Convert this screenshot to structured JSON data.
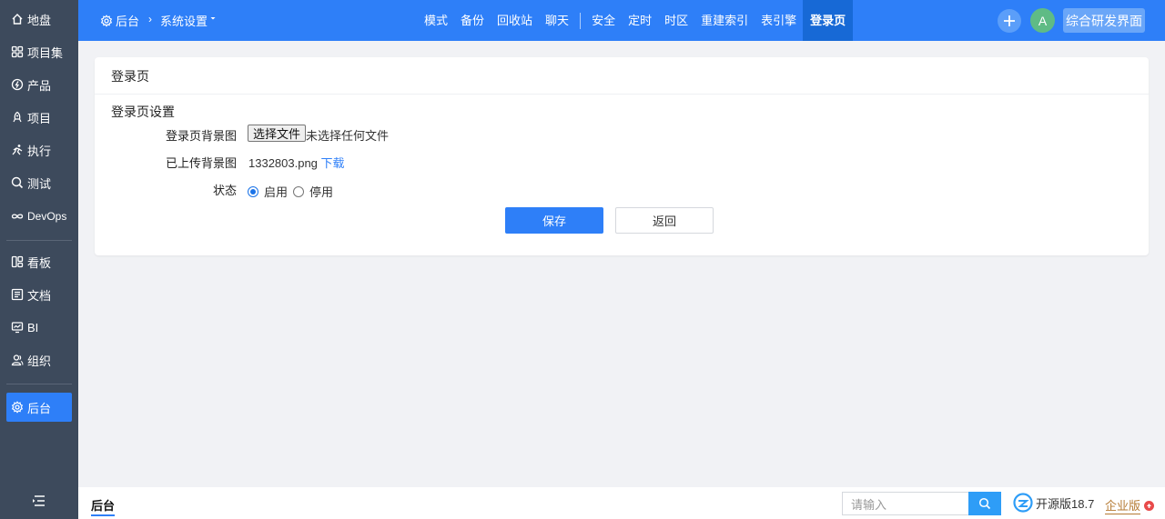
{
  "sidebar": {
    "items": [
      {
        "label": "地盘",
        "icon": "home-icon"
      },
      {
        "label": "项目集",
        "icon": "grid-icon"
      },
      {
        "label": "产品",
        "icon": "product-icon"
      },
      {
        "label": "项目",
        "icon": "project-icon"
      },
      {
        "label": "执行",
        "icon": "run-icon"
      },
      {
        "label": "测试",
        "icon": "test-icon"
      },
      {
        "label": "DevOps",
        "icon": "infinity-icon"
      },
      {
        "label": "看板",
        "icon": "kanban-icon"
      },
      {
        "label": "文档",
        "icon": "doc-icon"
      },
      {
        "label": "BI",
        "icon": "monitor-icon"
      },
      {
        "label": "组织",
        "icon": "people-icon"
      },
      {
        "label": "后台",
        "icon": "gear-icon"
      }
    ],
    "active": "后台"
  },
  "header": {
    "crumb_root": "后台",
    "crumb_current": "系统设置",
    "nav_group1": [
      "模式",
      "备份",
      "回收站",
      "聊天"
    ],
    "nav_group2": [
      "安全",
      "定时",
      "时区",
      "重建索引",
      "表引擎",
      "登录页"
    ],
    "active_nav": "登录页",
    "avatar_letter": "A",
    "switch_label": "综合研发界面"
  },
  "panel": {
    "title": "登录页",
    "section_title": "登录页设置",
    "bg_label": "登录页背景图",
    "choose_file_label": "选择文件",
    "no_file_text": "未选择任何文件",
    "uploaded_label": "已上传背景图",
    "uploaded_file": "1332803.png",
    "download_link": "下载",
    "status_label": "状态",
    "status_options": [
      "启用",
      "停用"
    ],
    "status_selected": "启用",
    "save_label": "保存",
    "back_label": "返回"
  },
  "footer": {
    "crumb": "后台",
    "search_placeholder": "请输入",
    "version": "开源版18.7",
    "enterprise": "企业版"
  },
  "colors": {
    "primary": "#2e7ff8",
    "sidebar_bg": "#3d4a5c",
    "enterprise": "#b57a33"
  }
}
